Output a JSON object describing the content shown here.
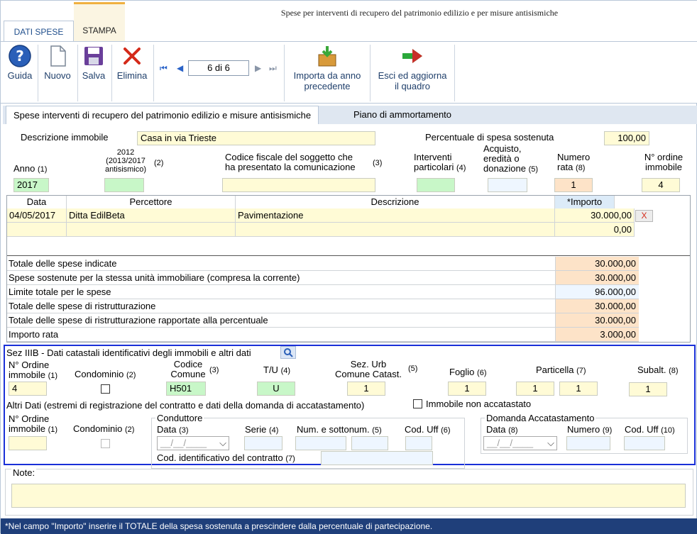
{
  "window": {
    "title": "Spese per interventi di recupero del patrimonio edilizio e per misure antisismiche"
  },
  "tabs": {
    "dati_spese": "DATI SPESE",
    "stampa": "STAMPA"
  },
  "ribbon": {
    "guida": "Guida",
    "nuovo": "Nuovo",
    "salva": "Salva",
    "elimina": "Elimina",
    "record_pos": "6 di 6",
    "importa_1": "Importa da anno",
    "importa_2": "precedente",
    "esci_1": "Esci ed aggiorna",
    "esci_2": "il quadro"
  },
  "subtabs": {
    "spese": "Spese interventi di recupero del patrimonio edilizio e misure antisismiche",
    "piano": "Piano di ammortamento"
  },
  "header": {
    "descrizione_label": "Descrizione immobile",
    "descrizione_value": "Casa in via Trieste",
    "percentuale_label": "Percentuale di spesa sostenuta",
    "percentuale_value": "100,00",
    "anno_label": "Anno",
    "anno_n": "(1)",
    "anno_value": "2017",
    "antis_l1": "2012",
    "antis_l2": "(2013/2017",
    "antis_l3": "antisismico)",
    "antis_n": "(2)",
    "cf_l1": "Codice fiscale del soggetto che",
    "cf_l2": "ha presentato la comunicazione",
    "cf_n": "(3)",
    "int_l1": "Interventi",
    "int_l2": "particolari",
    "int_n": "(4)",
    "acq_l1": "Acquisto,",
    "acq_l2": "eredità o",
    "acq_l3": "donazione",
    "acq_n": "(5)",
    "rata_l1": "Numero",
    "rata_l2": "rata",
    "rata_n": "(8)",
    "rata_value": "1",
    "ord_l1": "N° ordine",
    "ord_l2": "immobile",
    "ord_value": "4"
  },
  "grid": {
    "columns": [
      "Data",
      "Percettore",
      "Descrizione",
      "*Importo"
    ],
    "rows": [
      {
        "data": "04/05/2017",
        "percettore": "Ditta EdilBeta",
        "descrizione": "Pavimentazione",
        "importo": "30.000,00",
        "del": "X"
      },
      {
        "data": "",
        "percettore": "",
        "descrizione": "",
        "importo": "0,00"
      }
    ]
  },
  "totals": [
    {
      "label": "Totale delle spese indicate",
      "value": "30.000,00"
    },
    {
      "label": "Spese sostenute per la stessa unità immobiliare (compresa la corrente)",
      "value": "30.000,00"
    },
    {
      "label": "Limite totale per le spese",
      "value": "96.000,00"
    },
    {
      "label": "Totale delle spese di ristrutturazione",
      "value": "30.000,00"
    },
    {
      "label": "Totale delle spese di ristrutturazione rapportate alla percentuale",
      "value": "30.000,00"
    },
    {
      "label": "Importo rata",
      "value": "3.000,00"
    }
  ],
  "sez": {
    "title": "Sez IIIB - Dati catastali identificativi degli immobili e altri dati",
    "ord_l1": "N° Ordine",
    "ord_l2": "immobile",
    "ord_n": "(1)",
    "ord_value": "4",
    "cond_label": "Condominio",
    "cond_n": "(2)",
    "cc_l1": "Codice",
    "cc_l2": "Comune",
    "cc_n": "(3)",
    "cc_value": "H501",
    "tu_label": "T/U",
    "tu_n": "(4)",
    "tu_value": "U",
    "sez_l1": "Sez. Urb",
    "sez_l2": "Comune Catast.",
    "sez_n": "(5)",
    "sez_value": "1",
    "foglio_label": "Foglio",
    "foglio_n": "(6)",
    "foglio_value": "1",
    "part_label": "Particella",
    "part_n": "(7)",
    "part_value1": "1",
    "part_value2": "1",
    "sub_label": "Subalt.",
    "sub_n": "(8)",
    "sub_value": "1",
    "altri_label": "Altri Dati (estremi di registrazione del contratto e dati della domanda di accatastamento)",
    "non_acc_label": "Immobile non accatastato",
    "ord2_l1": "N° Ordine",
    "ord2_l2": "immobile",
    "ord2_n": "(1)",
    "cond2_label": "Condominio",
    "cond2_n": "(2)",
    "conduttore": "Conduttore",
    "data_label": "Data",
    "data_n": "(3)",
    "date_placeholder": "__/__/____",
    "serie_label": "Serie",
    "serie_n": "(4)",
    "num_label": "Num. e sottonum.",
    "num_n": "(5)",
    "coduff_label": "Cod. Uff",
    "coduff_n": "(6)",
    "codid_label": "Cod. identificativo del contratto",
    "codid_n": "(7)",
    "domanda": "Domanda Accatastamento",
    "ddata_label": "Data",
    "ddata_n": "(8)",
    "dnum_label": "Numero",
    "dnum_n": "(9)",
    "dcod_label": "Cod. Uff",
    "dcod_n": "(10)"
  },
  "notes": {
    "label": "Note:"
  },
  "footer": {
    "text": "*Nel campo \"Importo\" inserire il TOTALE della spesa sostenuta a prescindere dalla percentuale di partecipazione."
  }
}
